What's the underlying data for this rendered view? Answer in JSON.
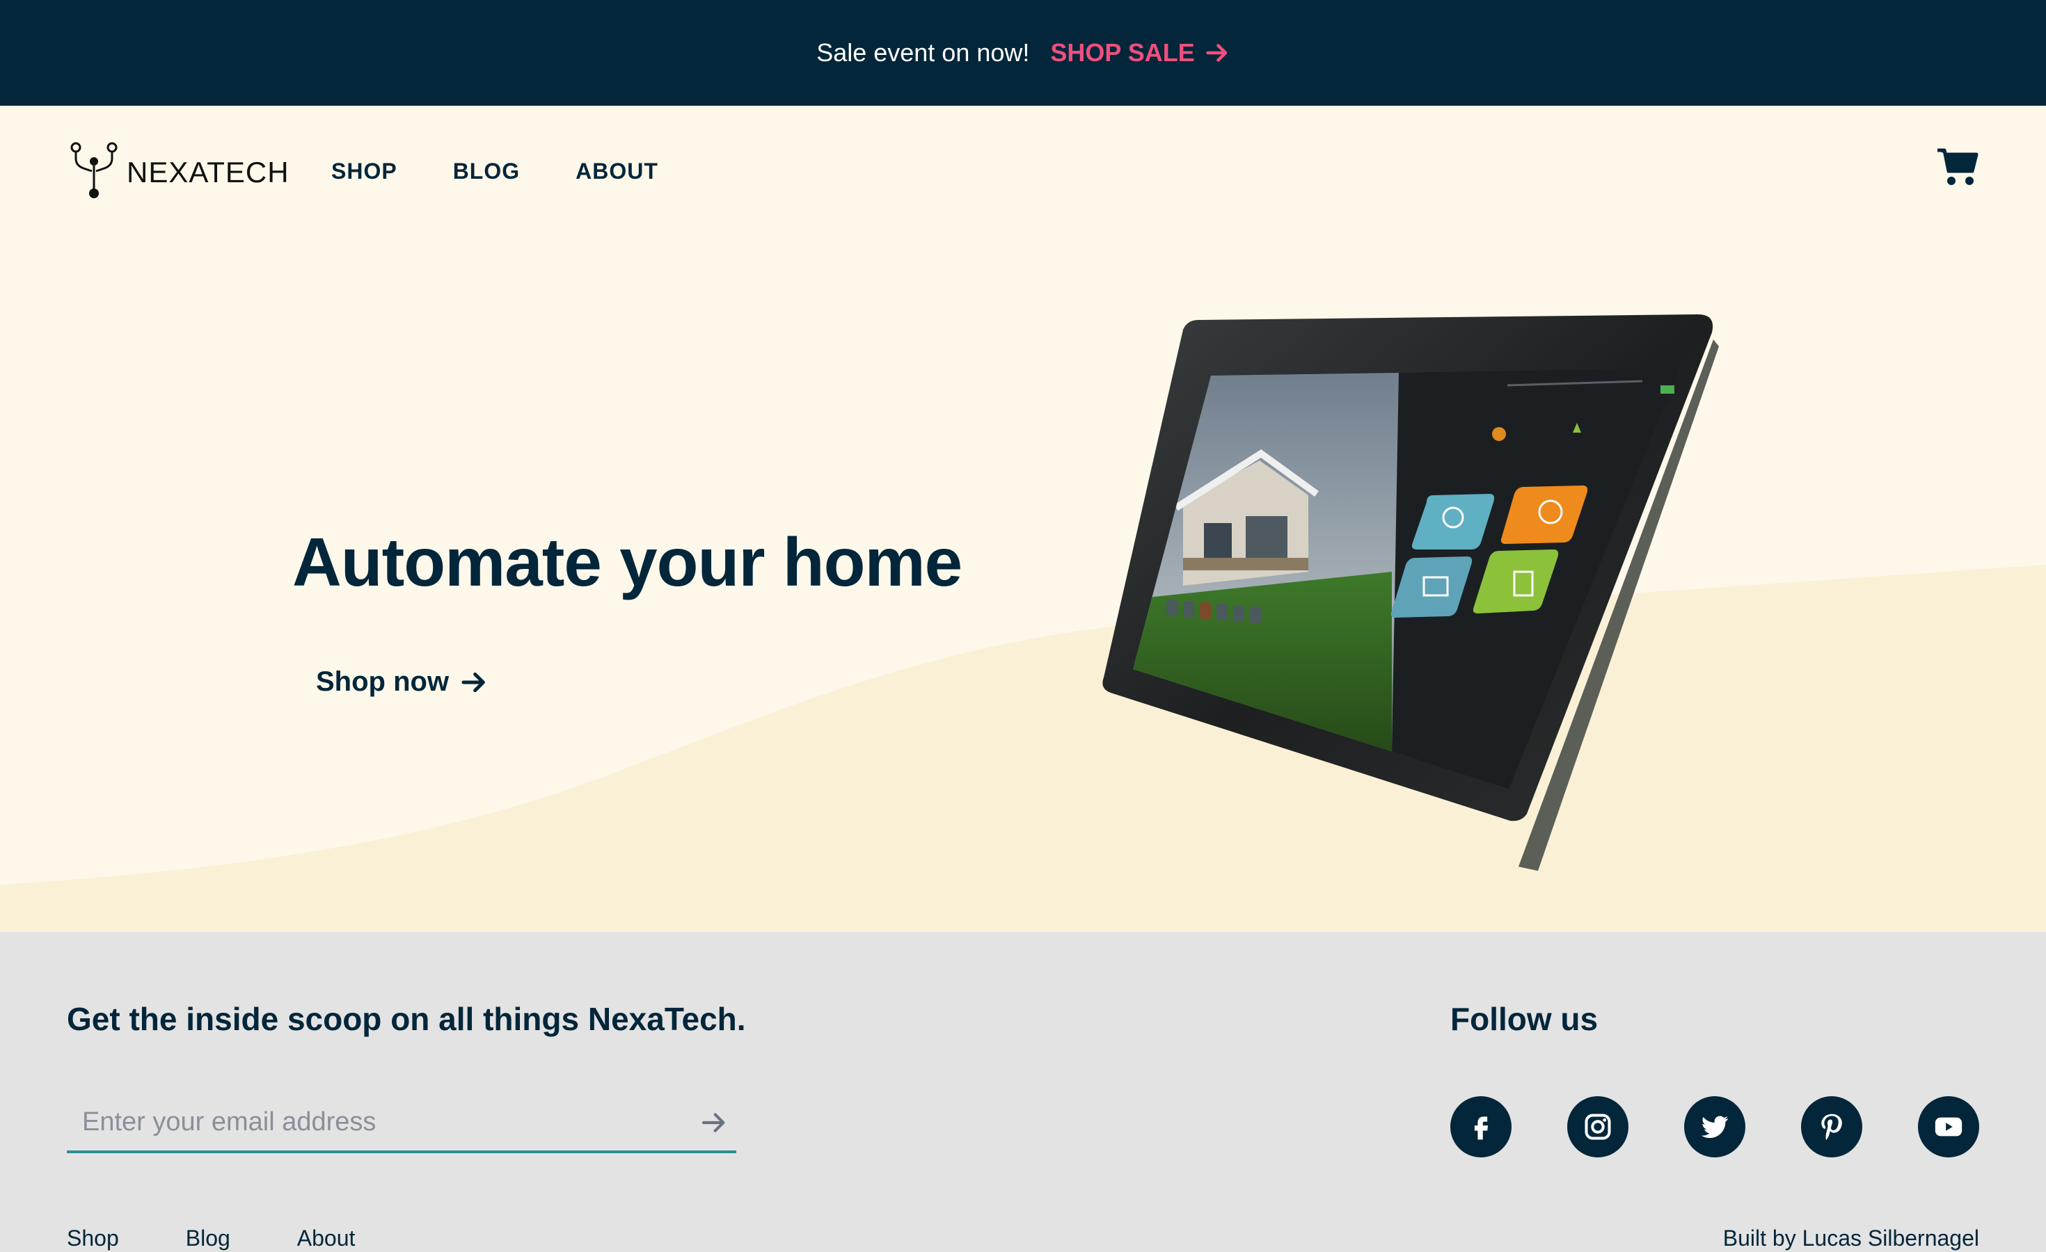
{
  "announcement": {
    "message": "Sale event on now!",
    "cta_label": "SHOP SALE",
    "cta_icon": "arrow-right-icon",
    "accent_color": "#ef4f7d",
    "background": "#03263a"
  },
  "header": {
    "logo_text": "NEXATECH",
    "logo_icon": "circuit-fork-icon",
    "nav": [
      {
        "label": "SHOP"
      },
      {
        "label": "BLOG"
      },
      {
        "label": "ABOUT"
      }
    ],
    "cart_icon": "shopping-cart-icon"
  },
  "hero": {
    "headline": "Automate your home",
    "cta_label": "Shop now",
    "cta_icon": "arrow-right-icon",
    "image": "smart-home-tablet",
    "background": "#fdf8ea",
    "wave_color": "#f9f0d6"
  },
  "newsletter": {
    "title": "Get the inside scoop on all things NexaTech.",
    "email_placeholder": "Enter your email address",
    "email_value": "",
    "submit_icon": "arrow-right-icon",
    "underline_color": "#2a8f94"
  },
  "social": {
    "title": "Follow us",
    "networks": [
      "facebook-icon",
      "instagram-icon",
      "twitter-icon",
      "pinterest-icon",
      "youtube-icon"
    ]
  },
  "footer": {
    "links": [
      {
        "label": "Shop"
      },
      {
        "label": "Blog"
      },
      {
        "label": "About"
      }
    ],
    "credit": "Built by Lucas Silbernagel"
  }
}
